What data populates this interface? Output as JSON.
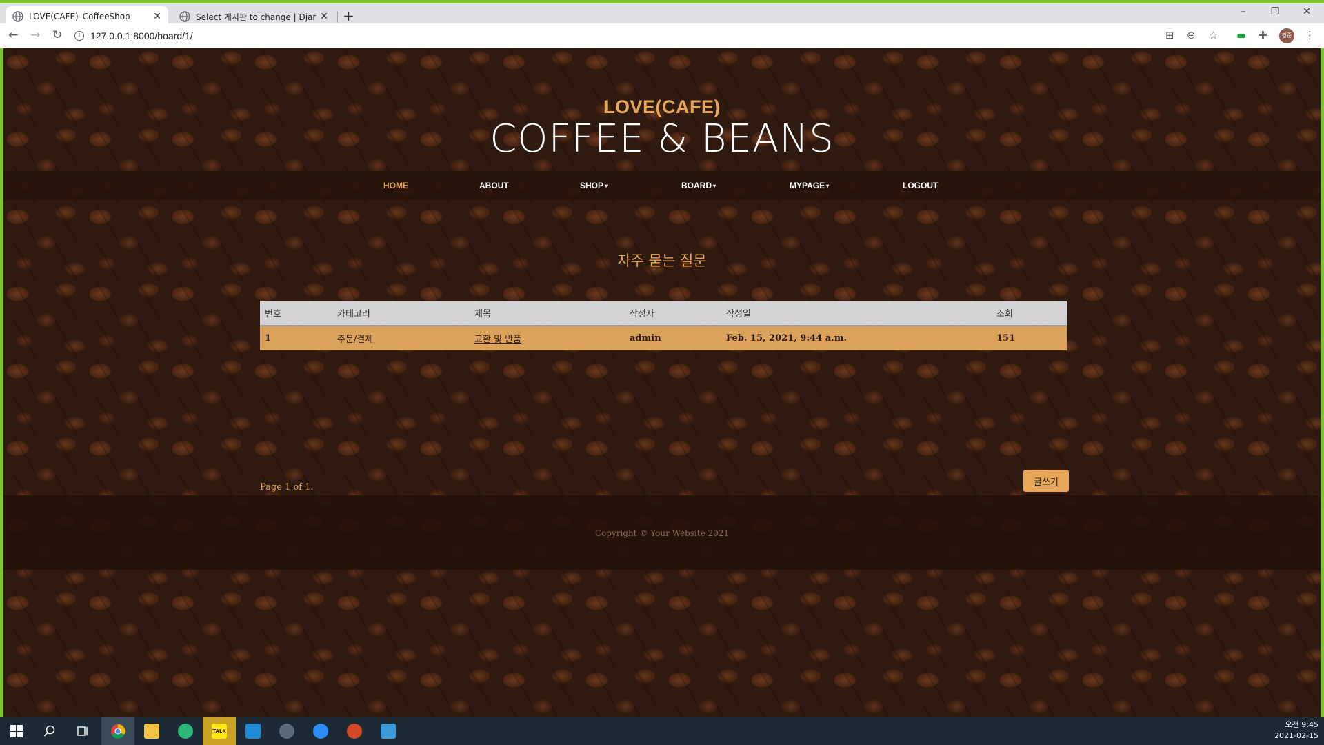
{
  "browser": {
    "tabs": [
      {
        "title": "LOVE(CAFE)_CoffeeShop",
        "active": true
      },
      {
        "title": "Select 게시판 to change | Djang",
        "active": false
      }
    ],
    "new_tab_label": "+",
    "url": "127.0.0.1:8000/board/1/",
    "window": {
      "minimize": "–",
      "restore": "❐",
      "close": "✕"
    },
    "avatar_text": "경준"
  },
  "site": {
    "brand_upper": "LOVE(CAFE)",
    "brand_lower": "COFFEE & BEANS",
    "nav": [
      {
        "label": "HOME",
        "active": true,
        "dropdown": false
      },
      {
        "label": "ABOUT",
        "active": false,
        "dropdown": false
      },
      {
        "label": "SHOP",
        "active": false,
        "dropdown": true
      },
      {
        "label": "BOARD",
        "active": false,
        "dropdown": true
      },
      {
        "label": "MYPAGE",
        "active": false,
        "dropdown": true
      },
      {
        "label": "LOGOUT",
        "active": false,
        "dropdown": false
      }
    ],
    "caret": "▾"
  },
  "board": {
    "title": "자주 묻는 질문",
    "columns": [
      "번호",
      "카테고리",
      "제목",
      "작성자",
      "작성일",
      "조회"
    ],
    "rows": [
      {
        "no": "1",
        "category": "주문/결제",
        "subject": "교환 및 반품",
        "author": "admin",
        "date": "Feb. 15, 2021, 9:44 a.m.",
        "views": "151"
      }
    ],
    "pagination": "Page 1 of 1.",
    "write_button": "글쓰기"
  },
  "footer": {
    "copyright": "Copyright © Your Website 2021"
  },
  "taskbar": {
    "apps": [
      "windows-start",
      "search",
      "task-view",
      "chrome",
      "file-explorer",
      "sourcetree",
      "kakaotalk",
      "vscode",
      "dbeaver",
      "zoom",
      "powerpoint",
      "notepad"
    ],
    "kakao_label": "TALK",
    "time": "오전 9:45",
    "date": "2021-02-15"
  },
  "colors": {
    "accent": "#e6a756",
    "bean_dark": "#2f1a10",
    "taskbar": "#1c2a36",
    "row_highlight": "#e2a860"
  }
}
